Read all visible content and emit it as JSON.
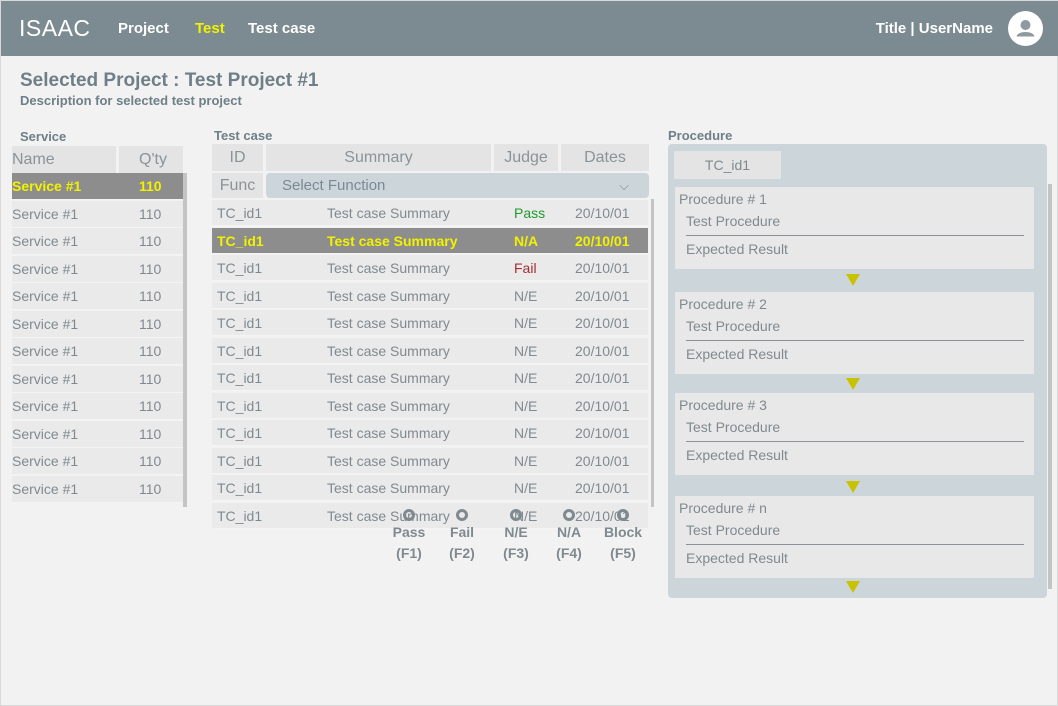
{
  "header": {
    "logo": "ISAAC",
    "nav": [
      {
        "label": "Project",
        "active": false
      },
      {
        "label": "Test",
        "active": true
      },
      {
        "label": "Test case",
        "active": false
      }
    ],
    "title_user": "Title | UserName",
    "avatar_icon": "user-icon"
  },
  "project": {
    "title": "Selected Project : Test Project #1",
    "description": "Description  for selected test project"
  },
  "service": {
    "label": "Service",
    "col_name": "Name",
    "col_qty": "Q'ty",
    "rows": [
      {
        "name": "Service #1",
        "qty": "110",
        "selected": true
      },
      {
        "name": "Service #1",
        "qty": "110"
      },
      {
        "name": "Service #1",
        "qty": "110"
      },
      {
        "name": "Service #1",
        "qty": "110"
      },
      {
        "name": "Service #1",
        "qty": "110"
      },
      {
        "name": "Service #1",
        "qty": "110"
      },
      {
        "name": "Service #1",
        "qty": "110"
      },
      {
        "name": "Service #1",
        "qty": "110"
      },
      {
        "name": "Service #1",
        "qty": "110"
      },
      {
        "name": "Service #1",
        "qty": "110"
      },
      {
        "name": "Service #1",
        "qty": "110"
      },
      {
        "name": "Service #1",
        "qty": "110"
      }
    ]
  },
  "testcase": {
    "label": "Test case",
    "col_id": "ID",
    "col_summary": "Summary",
    "col_judge": "Judge",
    "col_dates": "Dates",
    "func_label": "Func",
    "select_placeholder": "Select Function",
    "rows": [
      {
        "id": "TC_id1",
        "summary": "Test case Summary",
        "judge": "Pass",
        "date": "20/10/01"
      },
      {
        "id": "TC_id1",
        "summary": "Test case Summary",
        "judge": "N/A",
        "date": "20/10/01",
        "selected": true
      },
      {
        "id": "TC_id1",
        "summary": "Test case Summary",
        "judge": "Fail",
        "date": "20/10/01"
      },
      {
        "id": "TC_id1",
        "summary": "Test case Summary",
        "judge": "N/E",
        "date": "20/10/01"
      },
      {
        "id": "TC_id1",
        "summary": "Test case Summary",
        "judge": "N/E",
        "date": "20/10/01"
      },
      {
        "id": "TC_id1",
        "summary": "Test case Summary",
        "judge": "N/E",
        "date": "20/10/01"
      },
      {
        "id": "TC_id1",
        "summary": "Test case Summary",
        "judge": "N/E",
        "date": "20/10/01"
      },
      {
        "id": "TC_id1",
        "summary": "Test case Summary",
        "judge": "N/E",
        "date": "20/10/01"
      },
      {
        "id": "TC_id1",
        "summary": "Test case Summary",
        "judge": "N/E",
        "date": "20/10/01"
      },
      {
        "id": "TC_id1",
        "summary": "Test case Summary",
        "judge": "N/E",
        "date": "20/10/01"
      },
      {
        "id": "TC_id1",
        "summary": "Test case Summary",
        "judge": "N/E",
        "date": "20/10/01"
      },
      {
        "id": "TC_id1",
        "summary": "Test case Summary",
        "judge": "N/E",
        "date": "20/10/01"
      }
    ],
    "legend": [
      {
        "label": "Pass",
        "key": "(F1)"
      },
      {
        "label": "Fail",
        "key": "(F2)"
      },
      {
        "label": "N/E",
        "key": "(F3)"
      },
      {
        "label": "N/A",
        "key": "(F4)"
      },
      {
        "label": "Block",
        "key": "(F5)"
      }
    ]
  },
  "procedure": {
    "label": "Procedure",
    "tab": "TC_id1",
    "cards": [
      {
        "title": "Procedure # 1",
        "step": "Test Procedure",
        "result": "Expected Result"
      },
      {
        "title": "Procedure # 2",
        "step": "Test Procedure",
        "result": "Expected Result"
      },
      {
        "title": "Procedure # 3",
        "step": "Test Procedure",
        "result": "Expected Result"
      },
      {
        "title": "Procedure # n",
        "step": "Test Procedure",
        "result": "Expected Result"
      }
    ]
  },
  "colors": {
    "header_bg": "#7c8b91",
    "active_nav": "#f2f200",
    "selected_row_bg": "#8d8d8d",
    "pass": "#1f9a2a",
    "fail": "#a33030",
    "arrow": "#c9c200"
  }
}
